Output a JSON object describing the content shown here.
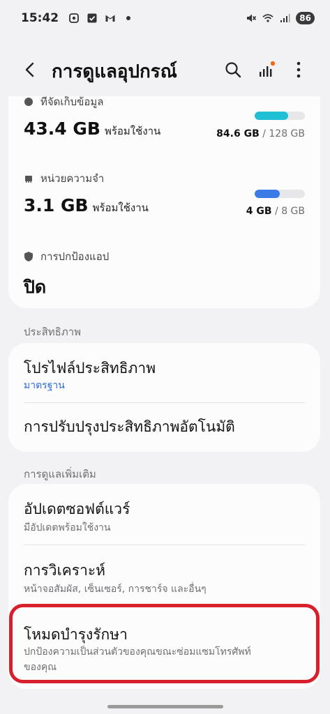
{
  "status_bar": {
    "time": "15:42",
    "battery": "86",
    "icons": [
      "screenshot-icon",
      "check-icon",
      "gmail-icon",
      "dot-icon",
      "mute-icon",
      "wifi-icon",
      "signal-icon"
    ]
  },
  "header": {
    "title": "การดูแลอุปกรณ์",
    "icons": [
      "back-icon",
      "search-icon",
      "diagnostics-icon",
      "more-icon"
    ],
    "notification_dot_color": "#f26b1d"
  },
  "storage": {
    "label": "ที่จัดเก็บข้อมูล",
    "value": "43.4 GB",
    "available_text": "พร้อมใช้งาน",
    "used": "84.6 GB",
    "separator": " / ",
    "total": "128 GB",
    "fill_fraction": 0.66,
    "bar_color": "#1fc0d3"
  },
  "memory": {
    "label": "หน่วยความจำ",
    "value": "3.1 GB",
    "available_text": "พร้อมใช้งาน",
    "used": "4 GB",
    "separator": " / ",
    "total": "8 GB",
    "fill_fraction": 0.5,
    "bar_color": "#3b7be8"
  },
  "app_protection": {
    "label": "การปกป้องแอป",
    "value": "ปิด"
  },
  "performance": {
    "section_title": "ประสิทธิภาพ",
    "profile_title": "โปรไฟล์ประสิทธิภาพ",
    "profile_value": "มาตรฐาน",
    "auto_optimize_title": "การปรับปรุงประสิทธิภาพอัตโนมัติ"
  },
  "additional_care": {
    "section_title": "การดูแลเพิ่มเติม",
    "software_update_title": "อัปเดตซอฟต์แวร์",
    "software_update_sub": "มีอัปเดตพร้อมใช้งาน",
    "diagnostics_title": "การวิเคราะห์",
    "diagnostics_sub": "หน้าจอสัมผัส, เซ็นเซอร์, การชาร์จ และอื่นๆ",
    "maintenance_title": "โหมดบำรุงรักษา",
    "maintenance_sub_line1": "ปกป้องความเป็นส่วนตัวของคุณขณะซ่อมแซมโทรศัพท์",
    "maintenance_sub_line2": "ของคุณ"
  },
  "highlight_color": "#d81f2c"
}
